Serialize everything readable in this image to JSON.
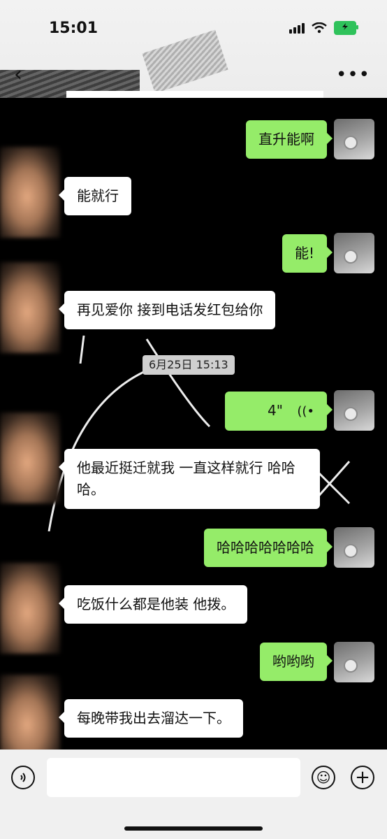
{
  "status_bar": {
    "time": "15:01"
  },
  "nav": {
    "back_icon": "‹",
    "more_icon": "•••"
  },
  "messages": [
    {
      "side": "right",
      "text": "直升能啊"
    },
    {
      "side": "left",
      "text": "能就行"
    },
    {
      "side": "right",
      "text": "能!"
    },
    {
      "side": "left",
      "text": "再见爱你 接到电话发红包给你"
    },
    {
      "side": "right",
      "voice_duration": "4\""
    },
    {
      "side": "left",
      "text": "  他最近挺迁就我 一直这样就行 哈哈哈。"
    },
    {
      "side": "right",
      "text": "哈哈哈哈哈哈哈"
    },
    {
      "side": "left",
      "text": "吃饭什么都是他装 他拨。"
    },
    {
      "side": "right",
      "text": "哟哟哟"
    },
    {
      "side": "left",
      "text": "每晚带我出去溜达一下。"
    }
  ],
  "timestamp": "6月25日 15:13",
  "input_bar": {
    "voice_icon": "voice-icon",
    "emoji_icon": "☺",
    "plus_icon": "+"
  },
  "colors": {
    "sent_bubble": "#95ec69",
    "received_bubble": "#ffffff",
    "background": "#000000"
  }
}
